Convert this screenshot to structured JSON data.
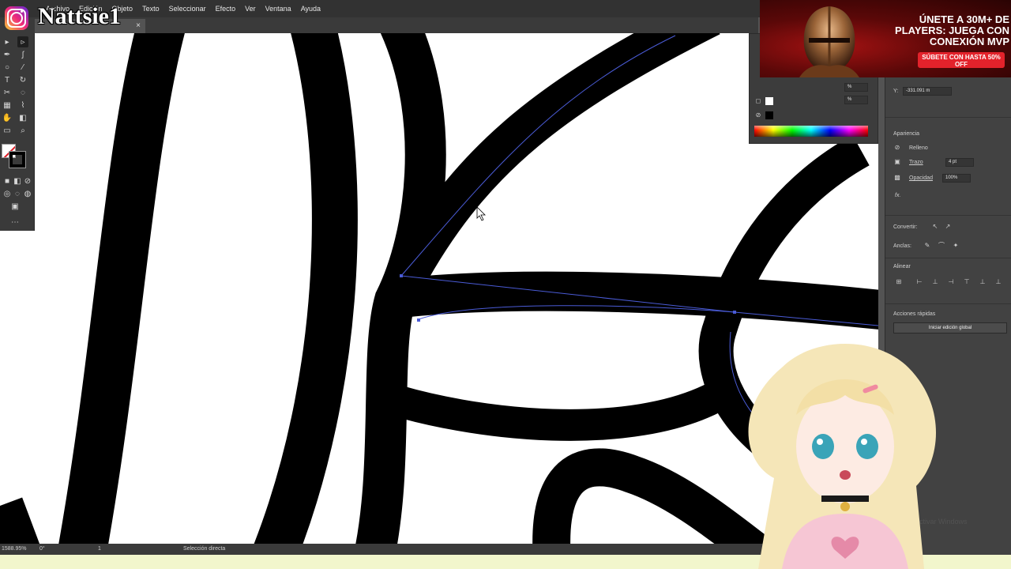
{
  "overlay": {
    "handle": "Nattsie1",
    "platform_icon": "instagram-icon"
  },
  "menubar": {
    "items": [
      "Archivo",
      "Edición",
      "Objeto",
      "Texto",
      "Seleccionar",
      "Efecto",
      "Ver",
      "Ventana",
      "Ayuda"
    ]
  },
  "tab": {
    "close": "×"
  },
  "statusbar": {
    "zoom": "1588.95%",
    "rotation": "0°",
    "artboard": "1",
    "tool_name": "Selección directa"
  },
  "transform": {
    "y_value": "-331.091 m",
    "y_label": "Y:",
    "unit_pct": "%"
  },
  "appearance": {
    "title": "Apariencia",
    "fill_label": "Relleno",
    "stroke_label": "Trazo",
    "stroke_weight": "4 pt",
    "opacity_label": "Opacidad",
    "opacity_value": "100%",
    "fx": "fx."
  },
  "anchor": {
    "convert_label": "Convertir:",
    "anchors_label": "Anclas:"
  },
  "align": {
    "title": "Alinear"
  },
  "quick_actions": {
    "title": "Acciones rápidas",
    "button": "Iniciar edición global"
  },
  "ad": {
    "headline": "ÚNETE A 30M+ DE PLAYERS: JUEGA CON CONEXIÓN MVP",
    "cta": "SÚBETE CON HASTA 50% OFF"
  },
  "watermark": "Activar Windows",
  "colors": {
    "accent_path": "#4a5bd6",
    "spectrum": "rainbow",
    "strip": "#f2f6cc"
  }
}
